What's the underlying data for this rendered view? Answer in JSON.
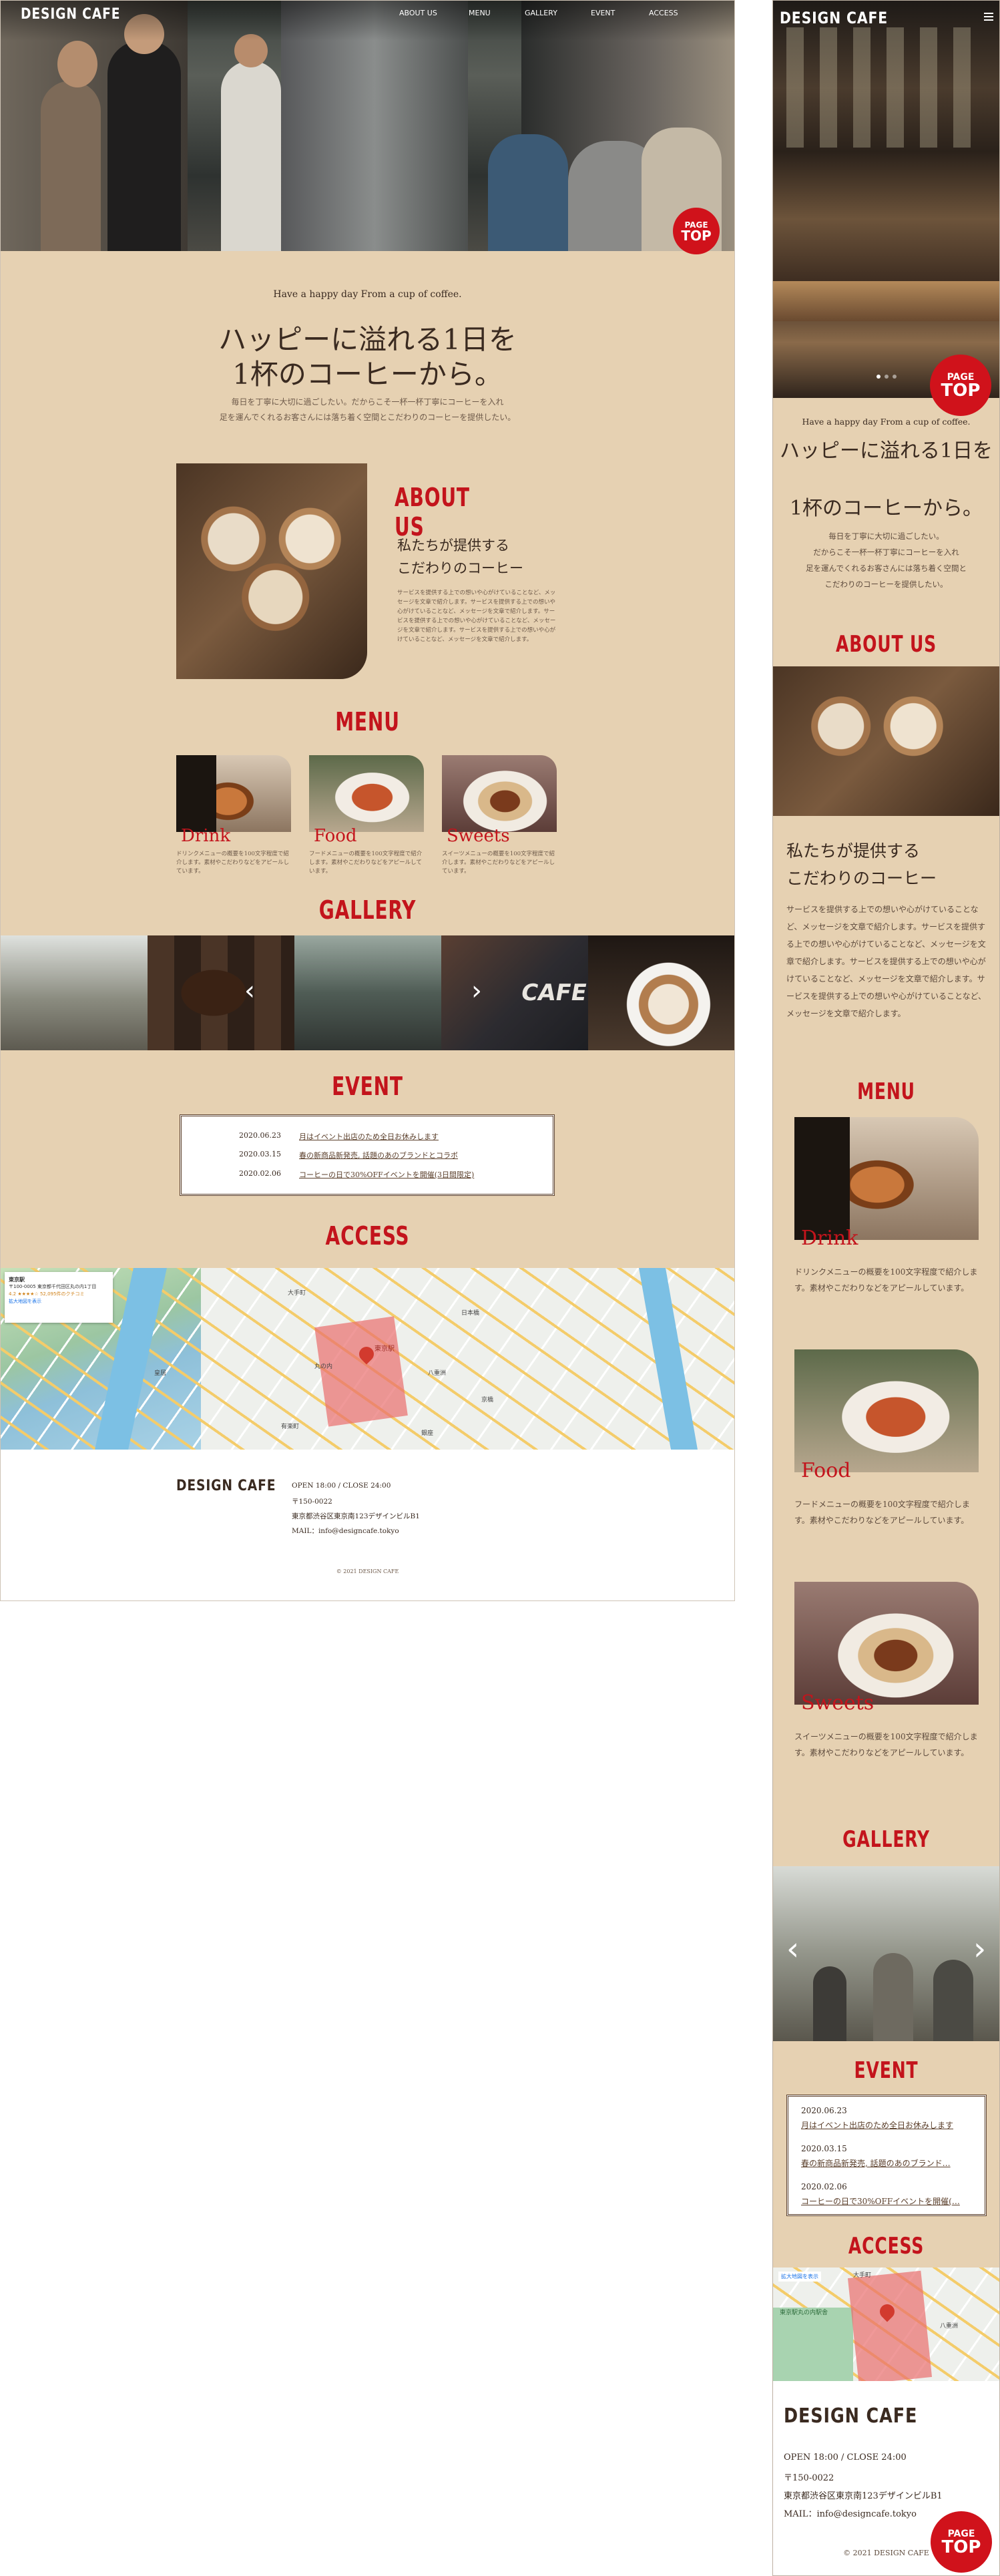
{
  "brand": "DESIGN CAFE",
  "nav": [
    "ABOUT US",
    "MENU",
    "GALLERY",
    "EVENT",
    "ACCESS"
  ],
  "page_top": {
    "line1": "PAGE",
    "line2": "TOP"
  },
  "intro": {
    "en": "Have a happy day From a cup of coffee.",
    "title1": "ハッピーに溢れる1日を",
    "title2": "1杯のコーヒーから。",
    "lead1": "毎日を丁寧に大切に過ごしたい。だからこそ一杯一杯丁寧にコーヒーを入れ",
    "lead2": "足を運んでくれるお客さんには落ち着く空間とこだわりのコーヒーを提供したい。",
    "mlead1": "毎日を丁寧に大切に過ごしたい。",
    "mlead2": "だからこそ一杯一杯丁寧にコーヒーを入れ",
    "mlead3": "足を運んでくれるお客さんには落ち着く空間と",
    "mlead4": "こだわりのコーヒーを提供したい。"
  },
  "about": {
    "title": "ABOUT US",
    "sub1": "私たちが提供する",
    "sub2": "こだわりのコーヒー",
    "body": "サービスを提供する上での想いや心がけていることなど、メッセージを文章で紹介します。サービスを提供する上での想いや心がけていることなど、メッセージを文章で紹介します。サービスを提供する上での想いや心がけていることなど、メッセージを文章で紹介します。サービスを提供する上での想いや心がけていることなど、メッセージを文章で紹介します。"
  },
  "menu": {
    "title": "MENU",
    "items": [
      {
        "name": "Drink",
        "desc": "ドリンクメニューの概要を100文字程度で紹介します。素材やこだわりなどをアピールしています。"
      },
      {
        "name": "Food",
        "desc": "フードメニューの概要を100文字程度で紹介します。素材やこだわりなどをアピールしています。"
      },
      {
        "name": "Sweets",
        "desc": "スイーツメニューの概要を100文字程度で紹介します。素材やこだわりなどをアピールしています。"
      }
    ]
  },
  "gallery": {
    "title": "GALLERY",
    "prev": "‹",
    "next": "›",
    "cafe_sign": "CAFE"
  },
  "event": {
    "title": "EVENT",
    "items": [
      {
        "date": "2020.06.23",
        "text": "月はイベント出店のため全日お休みします"
      },
      {
        "date": "2020.03.15",
        "text": "春の新商品新発売, 話題のあのブランドとコラボ"
      },
      {
        "date": "2020.02.06",
        "text": "コーヒーの日で30%OFFイベントを開催(3日間限定)"
      }
    ],
    "m_items": [
      {
        "date": "2020.06.23",
        "text": "月はイベント出店のため全日お休みします"
      },
      {
        "date": "2020.03.15",
        "text": "春の新商品新発売, 話題のあのブランド…"
      },
      {
        "date": "2020.02.06",
        "text": "コーヒーの日で30%OFFイベントを開催(…"
      }
    ]
  },
  "access": {
    "title": "ACCESS",
    "map_card": {
      "name": "東京駅",
      "addr": "〒100-0005 東京都千代田区丸の内1丁目",
      "rating": "4.2 ★★★★☆ 52,095件のクチコミ",
      "link": "拡大地図を表示"
    },
    "map_labels": [
      "東京駅",
      "大手町",
      "日本橋",
      "丸の内",
      "八重洲",
      "銀座",
      "有楽町",
      "京橋",
      "皇居",
      "東京駅丸の内駅舎"
    ]
  },
  "footer": {
    "open": "OPEN 18:00 / CLOSE 24:00",
    "zip": "〒150-0022",
    "addr": "東京都渋谷区東京南123デザインビルB1",
    "mail": "MAIL：info@designcafe.tokyo",
    "copy": "© 2021 DESIGN CAFE"
  },
  "colors": {
    "bg": "#e6d1b2",
    "accent": "#c3141c",
    "text": "#3a2a20"
  }
}
